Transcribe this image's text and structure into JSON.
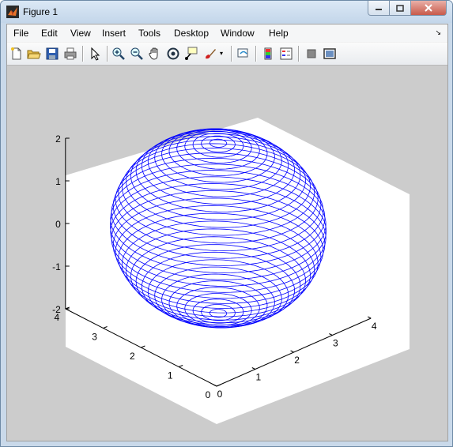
{
  "window": {
    "title": "Figure 1"
  },
  "menu": {
    "items": [
      "File",
      "Edit",
      "View",
      "Insert",
      "Tools",
      "Desktop",
      "Window",
      "Help"
    ]
  },
  "toolbar": {
    "icons": [
      "new-figure-icon",
      "open-icon",
      "save-icon",
      "print-icon",
      "pointer-icon",
      "zoom-in-icon",
      "zoom-out-icon",
      "pan-icon",
      "rotate-3d-icon",
      "data-cursor-icon",
      "brush-icon",
      "link-plot-icon",
      "colorbar-icon",
      "legend-icon",
      "hide-plot-tools-icon",
      "show-plot-tools-icon"
    ]
  },
  "colors": {
    "background": "#cccccc",
    "axes": "#ffffff",
    "mesh": "#0000ff"
  },
  "chart_data": {
    "type": "3d-mesh",
    "description_series": "ellipsoid",
    "center": [
      2,
      2,
      0
    ],
    "radii": [
      2,
      2,
      2
    ],
    "xlim": [
      0,
      4
    ],
    "ylim": [
      0,
      4
    ],
    "zlim": [
      -2,
      2
    ],
    "xticks": [
      "0",
      "1",
      "2",
      "3",
      "4"
    ],
    "yticks": [
      "0",
      "1",
      "2",
      "3",
      "4"
    ],
    "zticks": [
      "-2",
      "-1",
      "0",
      "1",
      "2"
    ],
    "mesh_color": "#0000ff",
    "grid": false
  }
}
